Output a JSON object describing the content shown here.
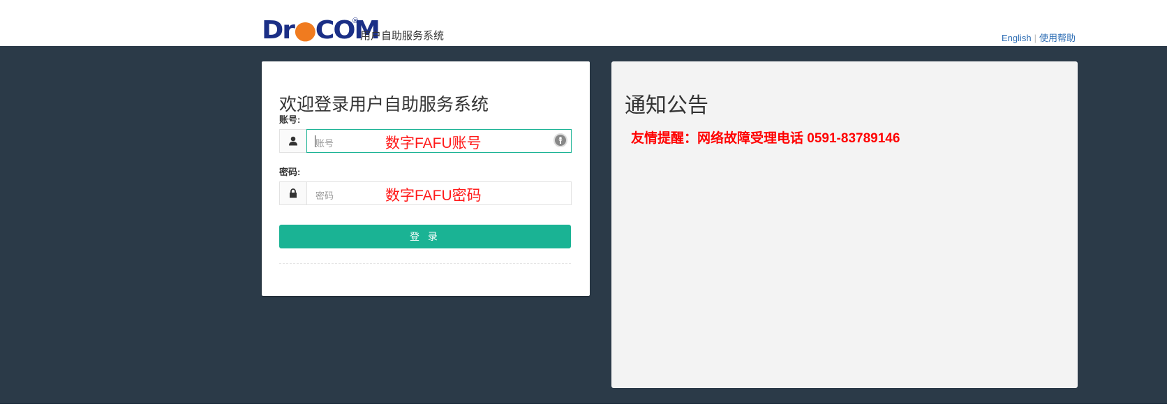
{
  "header": {
    "logo_text_left": "Dr",
    "logo_dot": "●",
    "logo_text_right": "COM",
    "logo_registered": "®",
    "system_name": "用户自助服务系统",
    "links": {
      "english": "English",
      "help": "使用帮助"
    }
  },
  "login": {
    "title": "欢迎登录用户自助服务系统",
    "account_label": "账号:",
    "account_placeholder": "账号",
    "account_overlay": "数字FAFU账号",
    "password_label": "密码:",
    "password_placeholder": "密码",
    "password_overlay": "数字FAFU密码",
    "submit_label": "登 录"
  },
  "notice": {
    "title": "通知公告",
    "text": "友情提醒：网络故障受理电话 0591-83789146"
  },
  "icons": {
    "account": "user-icon",
    "password": "lock-icon",
    "password_manager": "password-manager-icon"
  },
  "colors": {
    "brand_blue": "#1b2f86",
    "brand_orange": "#f07b1f",
    "band": "#2b3a48",
    "accent": "#1ab394",
    "notice_red": "#ff0000",
    "link": "#2a6bb3"
  }
}
